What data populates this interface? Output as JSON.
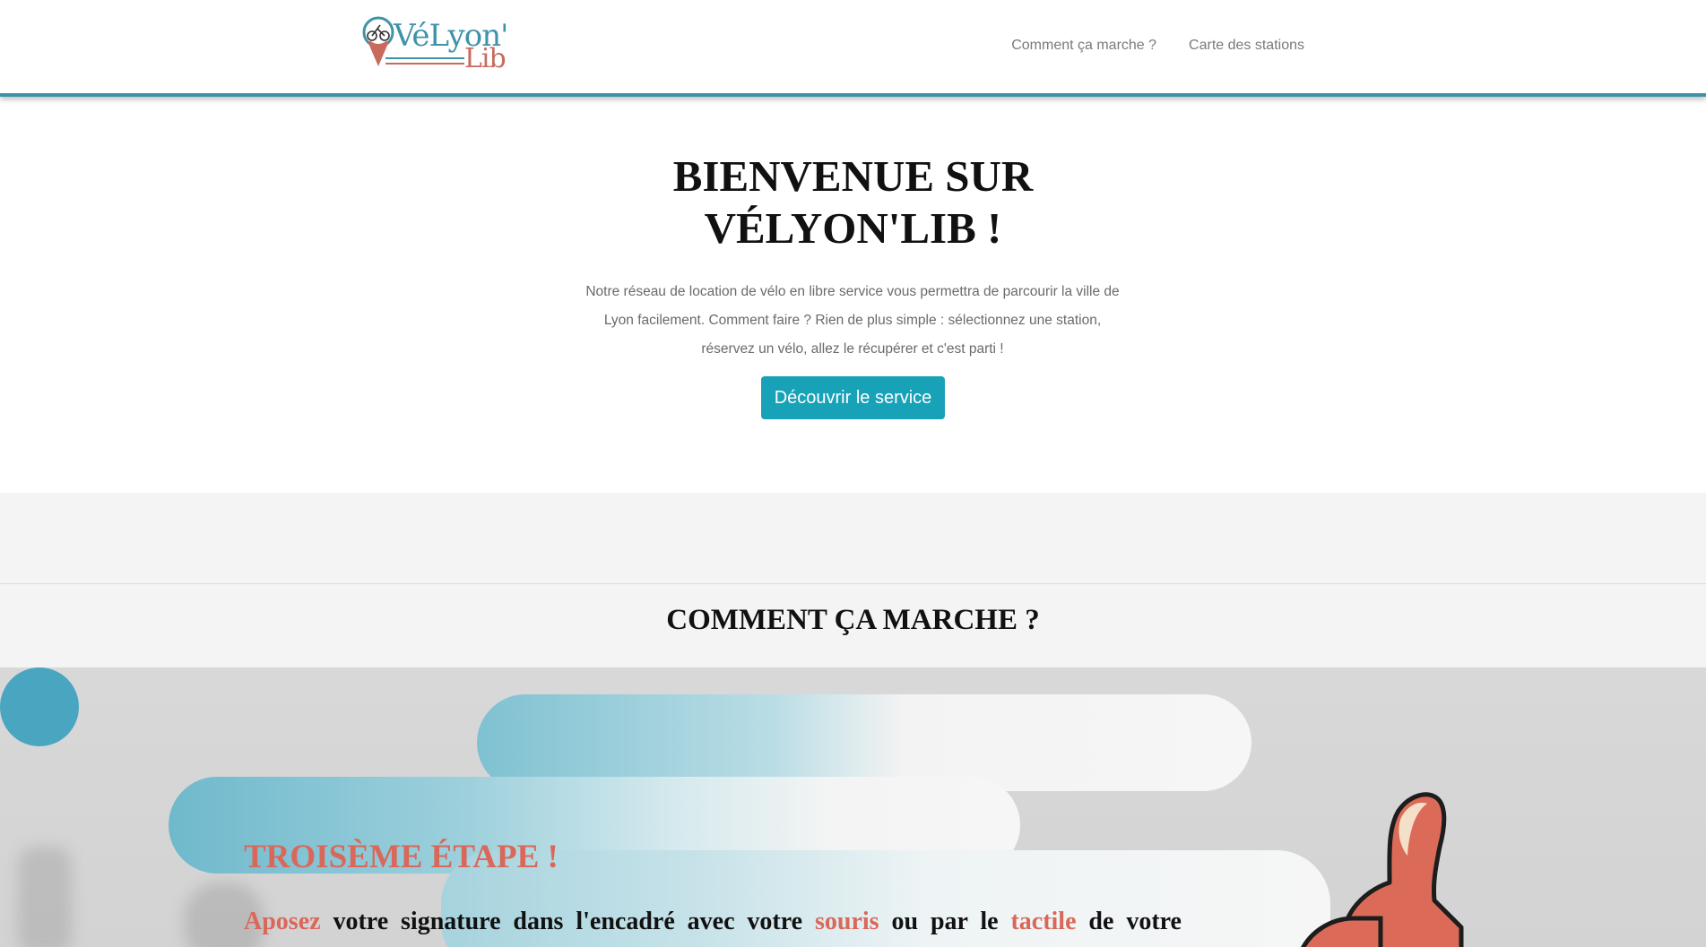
{
  "header": {
    "logo": {
      "text_main": "VéLyon'",
      "text_sub": "Lib",
      "icon": "bike-pin-icon"
    },
    "nav": [
      {
        "label": "Comment ça marche ?"
      },
      {
        "label": "Carte des stations"
      }
    ]
  },
  "hero": {
    "title_line1": "BIENVENUE SUR",
    "title_line2": "VÉLYON'LIB !",
    "description": "Notre réseau de location de vélo en libre service vous permettra de parcourir la ville de Lyon facilement. Comment faire ? Rien de plus simple : sélectionnez une station, réservez un vélo, allez le récupérer et c'est parti !",
    "button_label": "Découvrir le service"
  },
  "how_it_works": {
    "title": "COMMENT ÇA MARCHE ?",
    "step": {
      "title": "TROISÈME ÉTAPE !",
      "text_parts": [
        "Aposez",
        " votre signature dans l'encadré avec votre ",
        "souris",
        " ou par le ",
        "tactile",
        " de votre"
      ]
    }
  },
  "colors": {
    "accent": "#17a2b8",
    "brand_blue": "#3f93a8",
    "brand_red": "#d9685a",
    "band_grey": "#f4f4f4"
  }
}
